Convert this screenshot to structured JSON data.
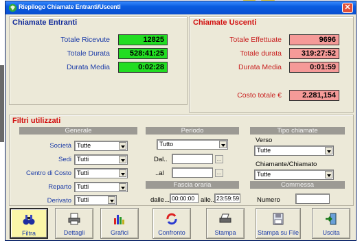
{
  "window": {
    "title": "Riepilogo Chiamate Entranti/Uscenti",
    "close_glyph": "✕"
  },
  "incoming": {
    "title": "Chiamate Entranti",
    "rows": [
      {
        "label": "Totale Ricevute",
        "value": "12825"
      },
      {
        "label": "Totale Durata",
        "value": "528:41:25"
      },
      {
        "label": "Durata Media",
        "value": "0:02:28"
      }
    ]
  },
  "outgoing": {
    "title": "Chiamate Uscenti",
    "rows": [
      {
        "label": "Totale Effettuate",
        "value": "9696"
      },
      {
        "label": "Totale durata",
        "value": "319:27:52"
      },
      {
        "label": "Durata Media",
        "value": "0:01:59"
      }
    ],
    "cost": {
      "label": "Costo totale €",
      "value": "2.281,154"
    }
  },
  "filters": {
    "title": "Filtri utilizzati",
    "generale": {
      "header": "Generale",
      "fields": [
        {
          "label": "Società",
          "value": "Tutte"
        },
        {
          "label": "Sedi",
          "value": "Tutti"
        },
        {
          "label": "Centro di Costo",
          "value": "Tutti"
        },
        {
          "label": "Reparto",
          "value": "Tutti"
        },
        {
          "label": "Derivato",
          "value": "Tutti"
        }
      ]
    },
    "periodo": {
      "header": "Periodo",
      "select": "Tutto",
      "dal_label": "Dal..",
      "al_label": "..al",
      "dal_value": "",
      "al_value": "",
      "dots": "..."
    },
    "fascia": {
      "header": "Fascia oraria",
      "dalle_label": "dalle...",
      "dalle_value": "00:00:00",
      "alle_label": "alle...",
      "alle_value": "23:59:59"
    },
    "tipo": {
      "header": "Tipo chiamate",
      "verso_label": "Verso",
      "verso_value": "Tutte",
      "chiamante_label": "Chiamante/Chiamato",
      "chiamante_value": "Tutte"
    },
    "commessa": {
      "header": "Commessa",
      "numero_label": "Numero",
      "numero_value": ""
    }
  },
  "toolbar": [
    {
      "label": "Filtra",
      "icon": "binoculars-icon"
    },
    {
      "label": "Dettagli",
      "icon": "printer-details-icon"
    },
    {
      "label": "Grafici",
      "icon": "bar-chart-icon"
    },
    {
      "label": "Confronto",
      "icon": "compare-icon"
    },
    {
      "label": "Stampa",
      "icon": "printer-icon"
    },
    {
      "label": "Stampa su File",
      "icon": "floppy-disk-icon"
    },
    {
      "label": "Uscita",
      "icon": "exit-icon"
    }
  ],
  "colors": {
    "green_value": "#22dd22",
    "pink_value": "#f59a98",
    "title_red": "#d21010",
    "label_blue": "#1c3ca8"
  }
}
